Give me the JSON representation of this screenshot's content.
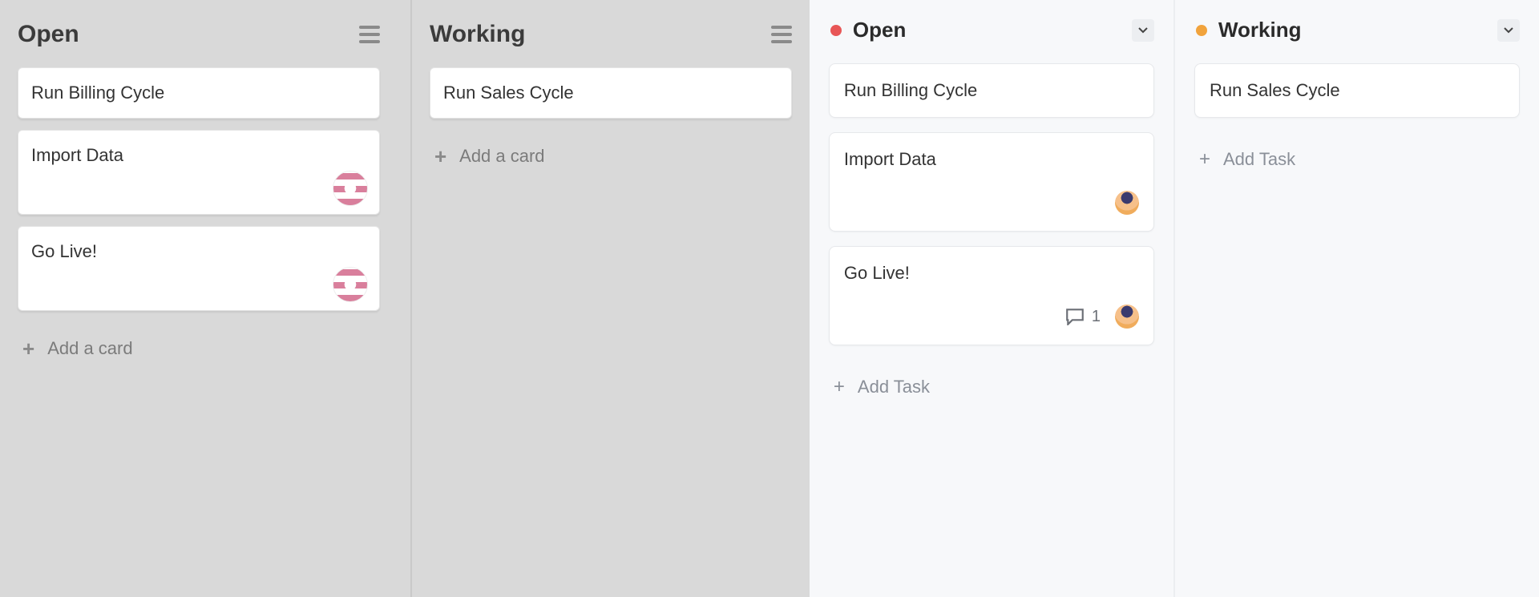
{
  "left_board": {
    "columns": [
      {
        "title": "Open",
        "add_label": "Add a card",
        "cards": [
          {
            "title": "Run Billing Cycle",
            "has_avatar": false
          },
          {
            "title": "Import Data",
            "has_avatar": true
          },
          {
            "title": "Go Live!",
            "has_avatar": true
          }
        ]
      },
      {
        "title": "Working",
        "add_label": "Add a card",
        "cards": [
          {
            "title": "Run Sales Cycle",
            "has_avatar": false
          }
        ]
      }
    ]
  },
  "right_board": {
    "columns": [
      {
        "title": "Open",
        "dot_color": "#e85656",
        "add_label": "Add Task",
        "cards": [
          {
            "title": "Run Billing Cycle",
            "has_avatar": false,
            "comments": null
          },
          {
            "title": "Import Data",
            "has_avatar": true,
            "comments": null
          },
          {
            "title": "Go Live!",
            "has_avatar": true,
            "comments": 1
          }
        ]
      },
      {
        "title": "Working",
        "dot_color": "#f1a33c",
        "add_label": "Add Task",
        "cards": [
          {
            "title": "Run Sales Cycle",
            "has_avatar": false,
            "comments": null
          }
        ]
      }
    ]
  }
}
